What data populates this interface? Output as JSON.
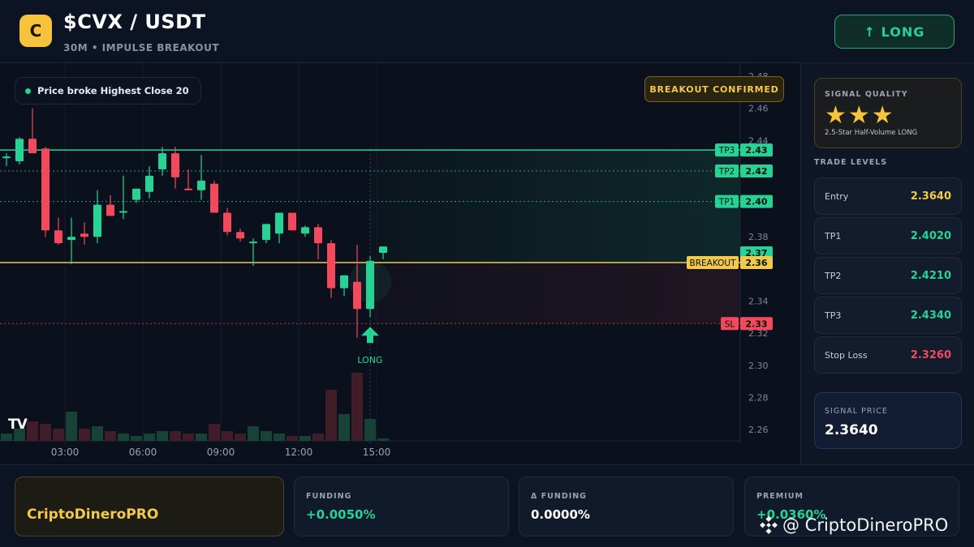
{
  "header": {
    "coin_letter": "C",
    "pair": "$CVX / USDT",
    "subtitle": "30M • IMPULSE BREAKOUT",
    "long_button": "↑ LONG"
  },
  "chart": {
    "info_pill": "Price broke Highest Close 20",
    "badge": "BREAKOUT CONFIRMED",
    "tv_logo": "TV",
    "signal_label": "LONG",
    "time_labels": [
      "03:00",
      "06:00",
      "09:00",
      "12:00",
      "15:00"
    ],
    "price_ticks": [
      "2.48",
      "2.46",
      "2.44",
      "2.38",
      "2.34",
      "2.32",
      "2.30",
      "2.28",
      "2.26"
    ],
    "level_tags": [
      {
        "label": "TP3",
        "price": "2.43",
        "value": 2.434,
        "color": "#26d394"
      },
      {
        "label": "TP2",
        "price": "2.42",
        "value": 2.421,
        "color": "#26d394"
      },
      {
        "label": "TP1",
        "price": "2.40",
        "value": 2.402,
        "color": "#26d394"
      },
      {
        "label": "",
        "price": "2.37",
        "value": 2.37,
        "color": "#26d394"
      },
      {
        "label": "BREAKOUT",
        "price": "2.36",
        "value": 2.364,
        "color": "#f2c94c"
      },
      {
        "label": "SL",
        "price": "2.33",
        "value": 2.326,
        "color": "#f2495c"
      }
    ],
    "colors": {
      "bull": "#26d394",
      "bear": "#f2495c",
      "breakout": "#f2c94c"
    }
  },
  "chart_data": {
    "type": "candlestick",
    "y_range": [
      2.255,
      2.48
    ],
    "candles": [
      {
        "o": 2.43,
        "h": 2.432,
        "l": 2.424,
        "c": 2.43
      },
      {
        "o": 2.427,
        "h": 2.442,
        "l": 2.425,
        "c": 2.441
      },
      {
        "o": 2.441,
        "h": 2.46,
        "l": 2.432,
        "c": 2.432
      },
      {
        "o": 2.435,
        "h": 2.436,
        "l": 2.38,
        "c": 2.384
      },
      {
        "o": 2.384,
        "h": 2.392,
        "l": 2.375,
        "c": 2.376
      },
      {
        "o": 2.378,
        "h": 2.392,
        "l": 2.363,
        "c": 2.38
      },
      {
        "o": 2.382,
        "h": 2.389,
        "l": 2.375,
        "c": 2.38
      },
      {
        "o": 2.38,
        "h": 2.409,
        "l": 2.376,
        "c": 2.4
      },
      {
        "o": 2.4,
        "h": 2.406,
        "l": 2.394,
        "c": 2.393
      },
      {
        "o": 2.395,
        "h": 2.418,
        "l": 2.391,
        "c": 2.396
      },
      {
        "o": 2.403,
        "h": 2.406,
        "l": 2.401,
        "c": 2.41
      },
      {
        "o": 2.408,
        "h": 2.424,
        "l": 2.404,
        "c": 2.418
      },
      {
        "o": 2.422,
        "h": 2.436,
        "l": 2.418,
        "c": 2.432
      },
      {
        "o": 2.432,
        "h": 2.436,
        "l": 2.41,
        "c": 2.417
      },
      {
        "o": 2.41,
        "h": 2.422,
        "l": 2.409,
        "c": 2.409
      },
      {
        "o": 2.409,
        "h": 2.431,
        "l": 2.403,
        "c": 2.415
      },
      {
        "o": 2.413,
        "h": 2.415,
        "l": 2.395,
        "c": 2.395
      },
      {
        "o": 2.395,
        "h": 2.398,
        "l": 2.381,
        "c": 2.383
      },
      {
        "o": 2.383,
        "h": 2.385,
        "l": 2.377,
        "c": 2.379
      },
      {
        "o": 2.376,
        "h": 2.379,
        "l": 2.362,
        "c": 2.377
      },
      {
        "o": 2.378,
        "h": 2.387,
        "l": 2.376,
        "c": 2.388
      },
      {
        "o": 2.382,
        "h": 2.395,
        "l": 2.376,
        "c": 2.395
      },
      {
        "o": 2.395,
        "h": 2.395,
        "l": 2.384,
        "c": 2.384
      },
      {
        "o": 2.382,
        "h": 2.387,
        "l": 2.38,
        "c": 2.386
      },
      {
        "o": 2.386,
        "h": 2.388,
        "l": 2.366,
        "c": 2.376
      },
      {
        "o": 2.376,
        "h": 2.378,
        "l": 2.342,
        "c": 2.348
      },
      {
        "o": 2.348,
        "h": 2.356,
        "l": 2.343,
        "c": 2.356
      },
      {
        "o": 2.352,
        "h": 2.375,
        "l": 2.317,
        "c": 2.335
      },
      {
        "o": 2.335,
        "h": 2.368,
        "l": 2.33,
        "c": 2.365
      },
      {
        "o": 2.37,
        "h": 2.373,
        "l": 2.366,
        "c": 2.374
      }
    ],
    "volume": [
      3,
      5,
      8,
      7,
      5,
      12,
      5,
      6,
      4,
      3,
      2,
      3,
      4,
      4,
      3,
      3,
      7,
      4,
      3,
      6,
      4,
      3,
      2,
      2,
      3,
      21,
      11,
      28,
      9,
      1
    ]
  },
  "side": {
    "quality_label": "SIGNAL QUALITY",
    "stars": "★★★",
    "quality_desc": "2.5-Star Half-Volume LONG",
    "levels_title": "TRADE LEVELS",
    "levels": [
      {
        "label": "Entry",
        "value": "2.3640",
        "color": "#f2c94c"
      },
      {
        "label": "TP1",
        "value": "2.4020",
        "color": "#26d394"
      },
      {
        "label": "TP2",
        "value": "2.4210",
        "color": "#26d394"
      },
      {
        "label": "TP3",
        "value": "2.4340",
        "color": "#26d394"
      },
      {
        "label": "Stop Loss",
        "value": "2.3260",
        "color": "#f2495c"
      }
    ],
    "signal_price_label": "SIGNAL PRICE",
    "signal_price": "2.3640"
  },
  "bottom": {
    "brand": "CriptoDineroPRO",
    "funding_label": "FUNDING",
    "funding_value": "+0.0050%",
    "dfunding_label": "Δ FUNDING",
    "dfunding_value": "0.0000%",
    "premium_label": "PREMIUM",
    "premium_value": "+0.0360%",
    "watermark": "@ CriptoDineroPRO"
  }
}
